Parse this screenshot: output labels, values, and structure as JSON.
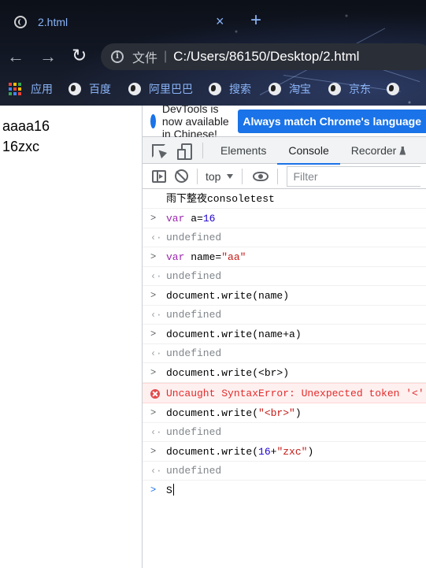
{
  "browser": {
    "tab_title": "2.html",
    "tab_close": "×",
    "new_tab": "+",
    "back": "←",
    "forward": "→",
    "reload": "↻",
    "omnibox_label": "文件",
    "omnibox_sep": "|",
    "url": "C:/Users/86150/Desktop/2.html",
    "bookmarks": [
      {
        "label": "应用",
        "icon": "apps-grid-icon"
      },
      {
        "label": "百度",
        "icon": "globe-icon"
      },
      {
        "label": "阿里巴巴",
        "icon": "globe-icon"
      },
      {
        "label": "搜索",
        "icon": "globe-icon"
      },
      {
        "label": "淘宝",
        "icon": "globe-icon"
      },
      {
        "label": "京东",
        "icon": "globe-icon"
      }
    ]
  },
  "page": {
    "lines": [
      "aaaa16",
      "16zxc"
    ]
  },
  "devtools": {
    "infobar_text": "DevTools is now available in Chinese!",
    "infobar_button": "Always match Chrome's language",
    "tabs": [
      "Elements",
      "Console",
      "Recorder"
    ],
    "active_tab": "Console",
    "context": "top",
    "filter_placeholder": "Filter",
    "console": [
      {
        "type": "log",
        "text": "雨下整夜consoletest"
      },
      {
        "type": "in",
        "parts": [
          {
            "t": "var",
            "c": "kw"
          },
          {
            "t": " a=",
            "c": ""
          },
          {
            "t": "16",
            "c": "num"
          }
        ]
      },
      {
        "type": "out",
        "text": "undefined"
      },
      {
        "type": "in",
        "parts": [
          {
            "t": "var",
            "c": "kw"
          },
          {
            "t": " name=",
            "c": ""
          },
          {
            "t": "\"aa\"",
            "c": "str"
          }
        ]
      },
      {
        "type": "out",
        "text": "undefined"
      },
      {
        "type": "in",
        "parts": [
          {
            "t": "document.write(name)",
            "c": ""
          }
        ]
      },
      {
        "type": "out",
        "text": "undefined"
      },
      {
        "type": "in",
        "parts": [
          {
            "t": "document.write(name+a)",
            "c": ""
          }
        ]
      },
      {
        "type": "out",
        "text": "undefined"
      },
      {
        "type": "in",
        "parts": [
          {
            "t": "document.write(<br>)",
            "c": ""
          }
        ]
      },
      {
        "type": "err",
        "text": "Uncaught SyntaxError: Unexpected token '<'"
      },
      {
        "type": "in",
        "parts": [
          {
            "t": "document.write(",
            "c": ""
          },
          {
            "t": "\"<br>\"",
            "c": "str"
          },
          {
            "t": ")",
            "c": ""
          }
        ]
      },
      {
        "type": "out",
        "text": "undefined"
      },
      {
        "type": "in",
        "parts": [
          {
            "t": "document.write(",
            "c": ""
          },
          {
            "t": "16",
            "c": "num"
          },
          {
            "t": "+",
            "c": ""
          },
          {
            "t": "\"zxc\"",
            "c": "str"
          },
          {
            "t": ")",
            "c": ""
          }
        ]
      },
      {
        "type": "out",
        "text": "undefined"
      }
    ],
    "prompt_value": "S"
  },
  "colors": {
    "accent": "#1a73e8",
    "link": "#8ab4f8",
    "error": "#e32b2b",
    "string": "#c41a16",
    "number": "#1c00cf",
    "keyword": "#9c27b0"
  }
}
